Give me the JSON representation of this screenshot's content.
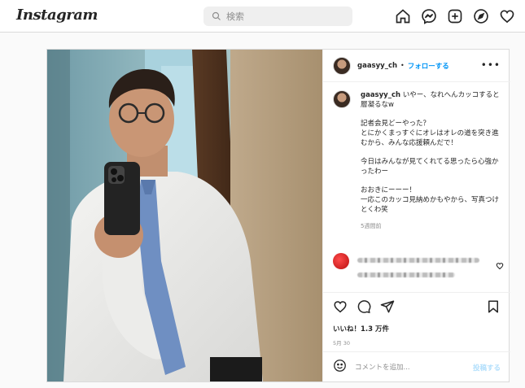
{
  "nav": {
    "logo": "Instagram",
    "search_placeholder": "検索",
    "icons": [
      "home-icon",
      "messenger-icon",
      "new-post-icon",
      "explore-icon",
      "activity-heart-icon"
    ]
  },
  "post": {
    "username": "gaasyy_ch",
    "separator": "•",
    "follow_label": "フォローする",
    "more_label": "•••",
    "caption": {
      "first_line": "いやー、なれへんカッコすると層凝るなw",
      "para2": "記者会見どーやった？\nとにかくまっすぐにオレはオレの道を突き進むから、みんな応援頼んだで！",
      "para3": "今日はみんなが見てくれてる思ったら心強かったわー",
      "para4": "おおきにーーー！\n一応このカッコ見納めかもやから、写真つけとくわ笑"
    },
    "time_ago": "5週間前",
    "likes": "いいね！1.3 万件",
    "date": "5月 30",
    "comment_placeholder": "コメントを追加...",
    "post_button": "投稿する"
  },
  "colors": {
    "accent": "#0095f6",
    "post_button_disabled": "#b2dffc",
    "muted": "#8e8e8e",
    "border": "#dbdbdb"
  }
}
